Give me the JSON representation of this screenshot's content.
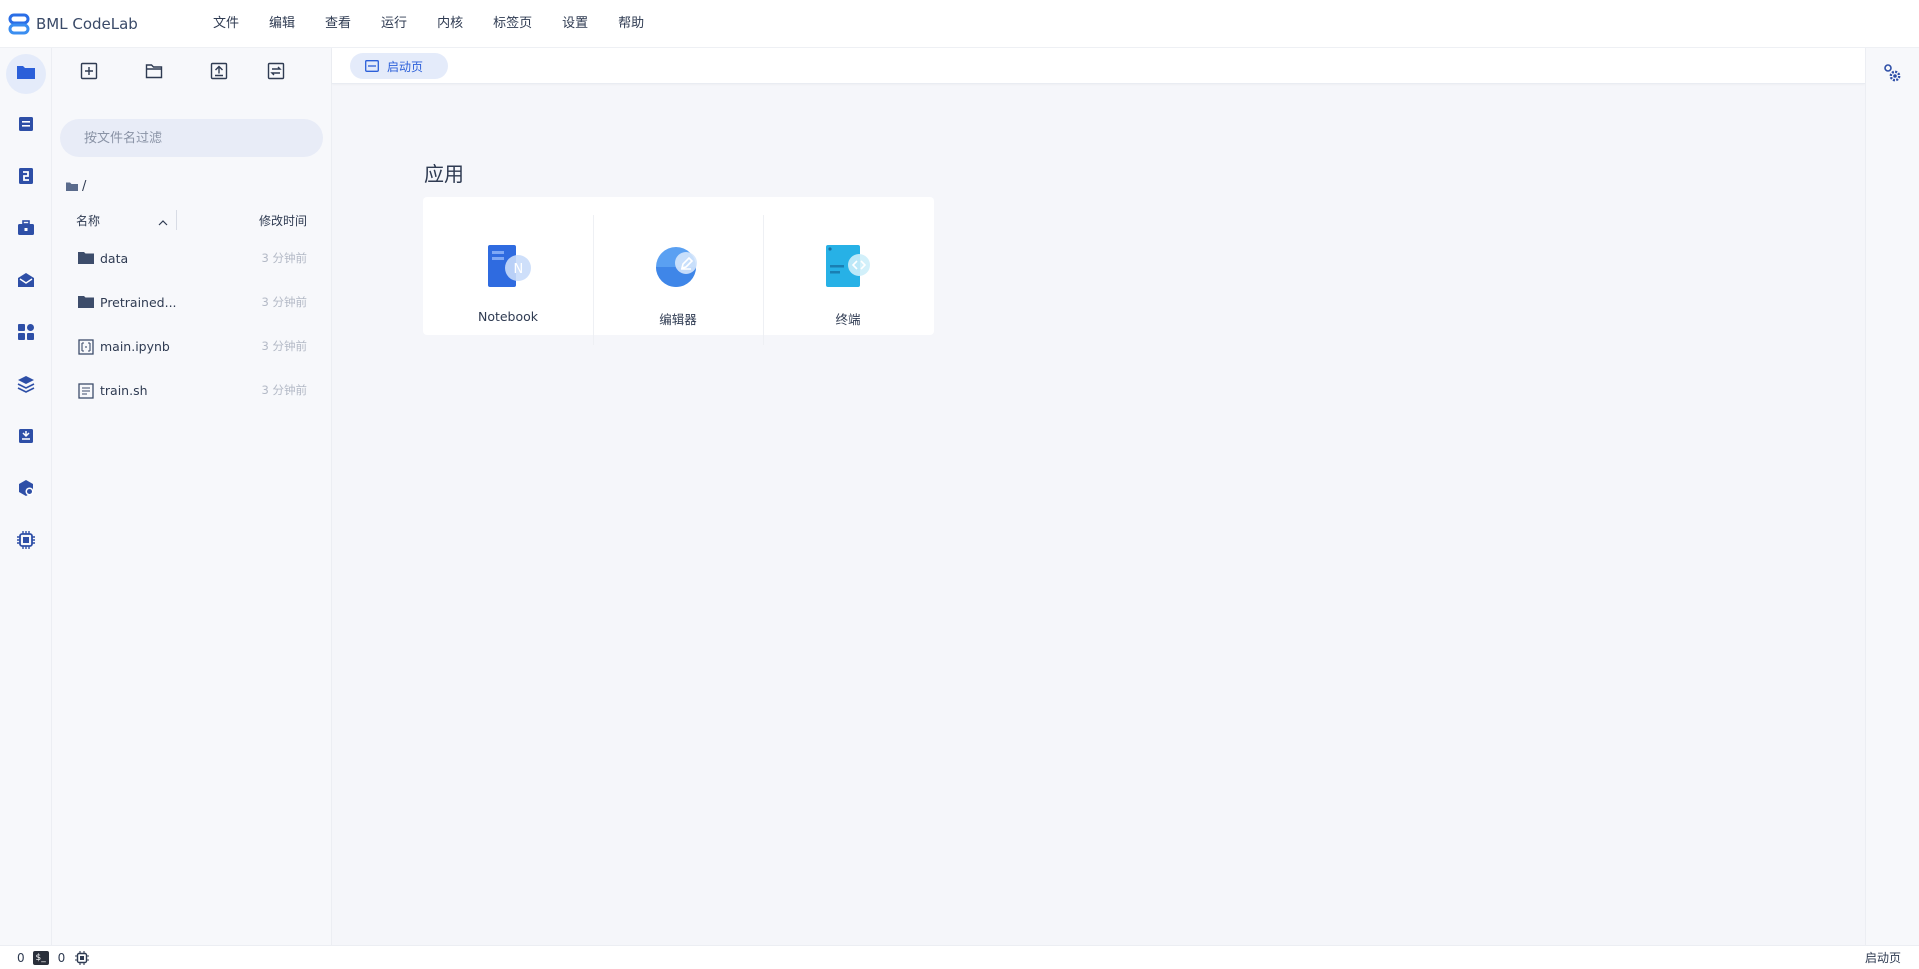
{
  "app": {
    "title": "BML CodeLab"
  },
  "menu": {
    "items": [
      "文件",
      "编辑",
      "查看",
      "运行",
      "内核",
      "标签页",
      "设置",
      "帮助"
    ]
  },
  "colors": {
    "accent": "#2b5fd9",
    "icon": "#2e4fa7",
    "active_bg": "#e4ebfa",
    "muted": "#b3b9c6"
  },
  "leftbar": {
    "items": [
      {
        "icon": "folder-icon",
        "active": true
      },
      {
        "icon": "server-icon",
        "active": false
      },
      {
        "icon": "dataset-icon",
        "active": false
      },
      {
        "icon": "toolbox-icon",
        "active": false
      },
      {
        "icon": "envelope-icon",
        "active": false
      },
      {
        "icon": "apps-icon",
        "active": false
      },
      {
        "icon": "layers-icon",
        "active": false
      },
      {
        "icon": "download-box-icon",
        "active": false
      },
      {
        "icon": "cloud-settings-icon",
        "active": false
      },
      {
        "icon": "chip-icon",
        "active": false
      }
    ]
  },
  "filebrowser": {
    "toolbar": {
      "icons": [
        "new-launcher-icon",
        "new-folder-icon",
        "upload-icon",
        "refresh-icon"
      ]
    },
    "filter": {
      "placeholder": "按文件名过滤",
      "value": ""
    },
    "breadcrumb": "/",
    "columns": {
      "name": "名称",
      "modified": "修改时间"
    },
    "files": [
      {
        "name": "data",
        "type": "folder",
        "modified": "3 分钟前"
      },
      {
        "name": "Pretrained...",
        "type": "folder",
        "modified": "3 分钟前"
      },
      {
        "name": "main.ipynb",
        "type": "notebook",
        "modified": "3 分钟前"
      },
      {
        "name": "train.sh",
        "type": "file",
        "modified": "3 分钟前"
      }
    ]
  },
  "tab": {
    "label": "启动页"
  },
  "launcher": {
    "section_title": "应用",
    "cards": [
      {
        "label": "Notebook",
        "icon": "notebook-icon"
      },
      {
        "label": "编辑器",
        "icon": "editor-icon"
      },
      {
        "label": "终端",
        "icon": "terminal-icon"
      }
    ]
  },
  "status": {
    "left_count": "0",
    "terminal_label": "$_",
    "right_count": "0",
    "right_text": "启动页"
  }
}
